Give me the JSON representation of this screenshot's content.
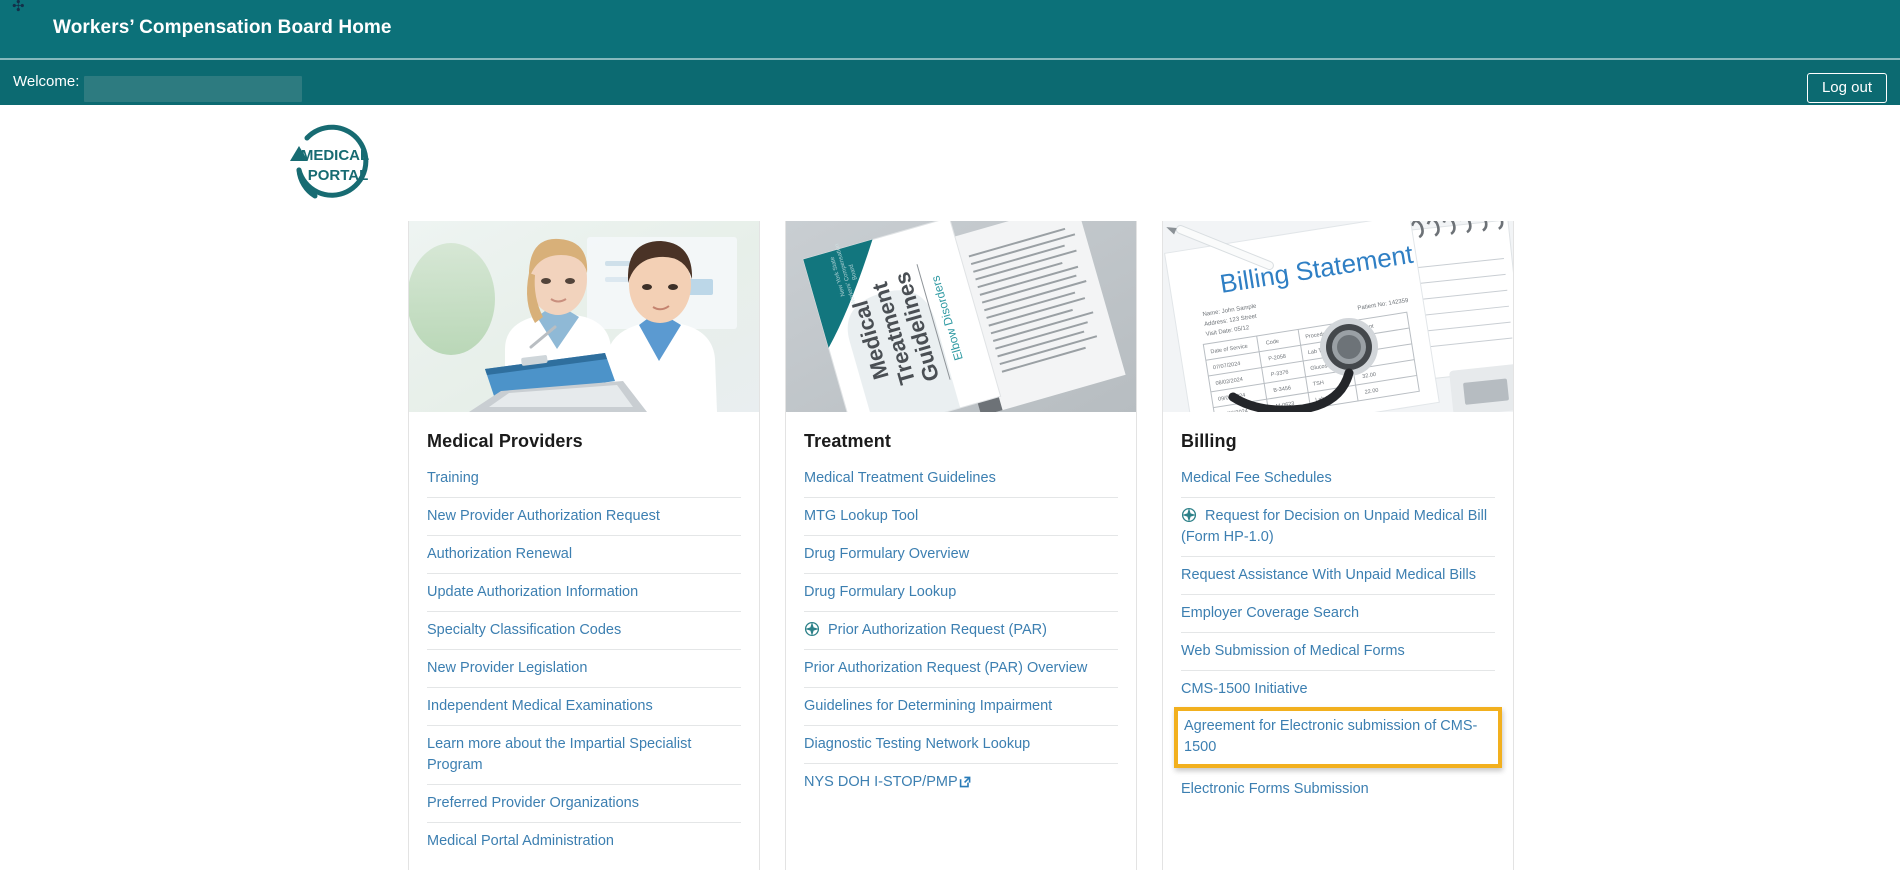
{
  "header": {
    "title": "Workers’ Compensation Board Home",
    "bar_color": "#0c7179",
    "welcome_label": "Welcome: ",
    "welcome_bar_color": "#0c6a71",
    "logout_label": "Log out"
  },
  "logo": {
    "line1": "MEDICAL",
    "line2": "PORTAL",
    "color": "#176b72"
  },
  "theme": {
    "link_color": "#3c7fb1",
    "highlight_color": "#f2b01e",
    "card_border": "#e3e3e3",
    "divider": "#e4e6e7"
  },
  "cards": [
    {
      "title": "Medical Providers",
      "image_alt": "two-clinicians-reviewing-chart-photo",
      "links": [
        {
          "label": "Training",
          "icon": null,
          "highlighted": false
        },
        {
          "label": "New Provider Authorization Request",
          "icon": null,
          "highlighted": false
        },
        {
          "label": "Authorization Renewal",
          "icon": null,
          "highlighted": false
        },
        {
          "label": "Update Authorization Information",
          "icon": null,
          "highlighted": false
        },
        {
          "label": "Specialty Classification Codes",
          "icon": null,
          "highlighted": false
        },
        {
          "label": "New Provider Legislation",
          "icon": null,
          "highlighted": false
        },
        {
          "label": "Independent Medical Examinations",
          "icon": null,
          "highlighted": false
        },
        {
          "label": "Learn more about the Impartial Specialist Program",
          "icon": null,
          "highlighted": false
        },
        {
          "label": "Preferred Provider Organizations",
          "icon": null,
          "highlighted": false
        },
        {
          "label": "Medical Portal Administration",
          "icon": null,
          "highlighted": false
        }
      ]
    },
    {
      "title": "Treatment",
      "image_alt": "medical-treatment-guidelines-booklet-photo",
      "links": [
        {
          "label": "Medical Treatment Guidelines",
          "icon": null,
          "highlighted": false
        },
        {
          "label": "MTG Lookup Tool",
          "icon": null,
          "highlighted": false
        },
        {
          "label": "Drug Formulary Overview",
          "icon": null,
          "highlighted": false
        },
        {
          "label": "Drug Formulary Lookup",
          "icon": null,
          "highlighted": false
        },
        {
          "label": "Prior Authorization Request (PAR)",
          "icon": "compass-icon",
          "highlighted": false
        },
        {
          "label": "Prior Authorization Request (PAR) Overview",
          "icon": null,
          "highlighted": false
        },
        {
          "label": "Guidelines for Determining Impairment",
          "icon": null,
          "highlighted": false
        },
        {
          "label": "Diagnostic Testing Network Lookup",
          "icon": null,
          "highlighted": false
        },
        {
          "label": "NYS DOH I-STOP/PMP",
          "icon": null,
          "icon_after": "external-link-icon",
          "highlighted": false
        }
      ]
    },
    {
      "title": "Billing",
      "image_alt": "billing-statement-with-stethoscope-photo",
      "links": [
        {
          "label": "Medical Fee Schedules",
          "icon": null,
          "highlighted": false
        },
        {
          "label": "Request for Decision on Unpaid Medical Bill (Form HP-1.0)",
          "icon": "compass-icon",
          "highlighted": false
        },
        {
          "label": "Request Assistance With Unpaid Medical Bills",
          "icon": null,
          "highlighted": false
        },
        {
          "label": "Employer Coverage Search",
          "icon": null,
          "highlighted": false
        },
        {
          "label": "Web Submission of Medical Forms",
          "icon": null,
          "highlighted": false
        },
        {
          "label": "CMS-1500 Initiative",
          "icon": null,
          "highlighted": false
        },
        {
          "label": "Agreement for Electronic submission of CMS-1500",
          "icon": null,
          "highlighted": true
        },
        {
          "label": "Electronic Forms Submission",
          "icon": null,
          "highlighted": false
        }
      ]
    }
  ]
}
